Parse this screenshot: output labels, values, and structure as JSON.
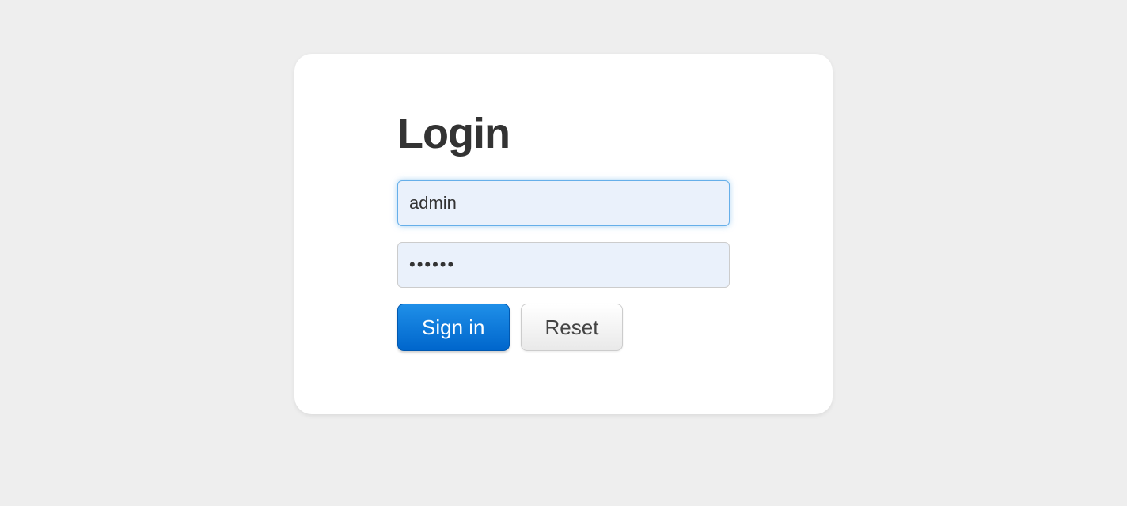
{
  "login": {
    "title": "Login",
    "username_value": "admin",
    "password_value": "••••••",
    "signin_label": "Sign in",
    "reset_label": "Reset"
  }
}
